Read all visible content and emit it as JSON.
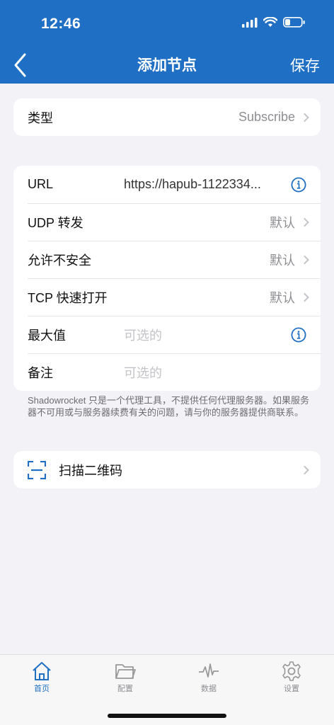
{
  "status_bar": {
    "time": "12:46",
    "icons": [
      "cellular-signal-icon",
      "wifi-icon",
      "battery-icon"
    ]
  },
  "nav": {
    "back_icon": "chevron-left-icon",
    "title": "添加节点",
    "save_label": "保存"
  },
  "type_row": {
    "label": "类型",
    "value": "Subscribe"
  },
  "settings": {
    "url": {
      "label": "URL",
      "value": "https://hapub-1122334..."
    },
    "udp": {
      "label": "UDP 转发",
      "value": "默认"
    },
    "insecure": {
      "label": "允许不安全",
      "value": "默认"
    },
    "tcp_fast_open": {
      "label": "TCP 快速打开",
      "value": "默认"
    },
    "max": {
      "label": "最大值",
      "placeholder": "可选的"
    },
    "remark": {
      "label": "备注",
      "placeholder": "可选的"
    }
  },
  "footnote": "Shadowrocket 只是一个代理工具，不提供任何代理服务器。如果服务器不可用或与服务器续费有关的问题，请与你的服务器提供商联系。",
  "scan": {
    "label": "扫描二维码",
    "icon": "qr-scan-icon"
  },
  "tabs": [
    {
      "label": "首页",
      "icon": "home-icon",
      "active": true
    },
    {
      "label": "配置",
      "icon": "folder-icon",
      "active": false
    },
    {
      "label": "数据",
      "icon": "activity-icon",
      "active": false
    },
    {
      "label": "设置",
      "icon": "gear-icon",
      "active": false
    }
  ],
  "colors": {
    "accent": "#1f6fc4",
    "background": "#f2f2f7",
    "secondary_text": "#8e8e93"
  }
}
